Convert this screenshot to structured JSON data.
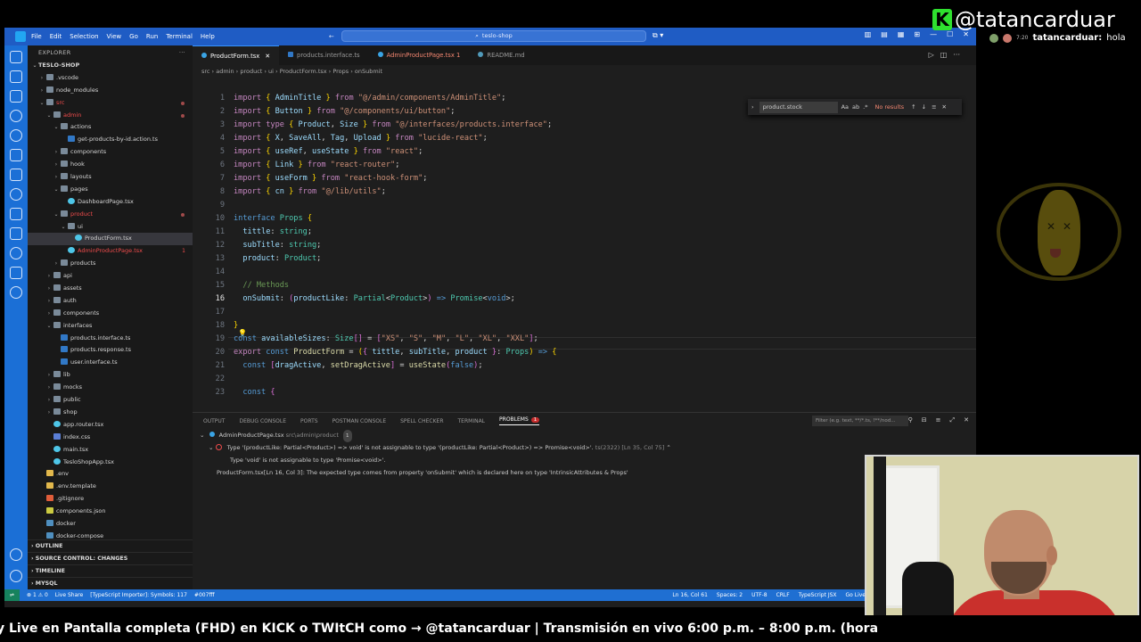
{
  "window": {
    "menu": [
      "File",
      "Edit",
      "Selection",
      "View",
      "Go",
      "Run",
      "Terminal",
      "Help"
    ],
    "search": "teslo-shop"
  },
  "explorer": {
    "title": "EXPLORER",
    "project": "TESLO-SHOP",
    "rows": [
      {
        "label": ".vscode",
        "depth": 1,
        "type": "folder",
        "open": false
      },
      {
        "label": "node_modules",
        "depth": 1,
        "type": "folder",
        "open": false
      },
      {
        "label": "src",
        "depth": 1,
        "type": "folder",
        "open": true,
        "error": true
      },
      {
        "label": "admin",
        "depth": 2,
        "type": "folder",
        "open": true,
        "error": true
      },
      {
        "label": "actions",
        "depth": 3,
        "type": "folder",
        "open": true
      },
      {
        "label": "get-products-by-id.action.ts",
        "depth": 4,
        "type": "ts"
      },
      {
        "label": "components",
        "depth": 3,
        "type": "folder",
        "open": false
      },
      {
        "label": "hook",
        "depth": 3,
        "type": "folder",
        "open": false
      },
      {
        "label": "layouts",
        "depth": 3,
        "type": "folder",
        "open": false
      },
      {
        "label": "pages",
        "depth": 3,
        "type": "folder",
        "open": true
      },
      {
        "label": "DashboardPage.tsx",
        "depth": 4,
        "type": "tsx"
      },
      {
        "label": "product",
        "depth": 3,
        "type": "folder",
        "open": true,
        "error": true
      },
      {
        "label": "ui",
        "depth": 4,
        "type": "folder",
        "open": true
      },
      {
        "label": "ProductForm.tsx",
        "depth": 5,
        "type": "tsx",
        "selected": true
      },
      {
        "label": "AdminProductPage.tsx",
        "depth": 4,
        "type": "tsx",
        "error": true,
        "badge": "1"
      },
      {
        "label": "products",
        "depth": 3,
        "type": "folder",
        "open": false
      },
      {
        "label": "api",
        "depth": 2,
        "type": "folder",
        "open": false
      },
      {
        "label": "assets",
        "depth": 2,
        "type": "folder",
        "open": false
      },
      {
        "label": "auth",
        "depth": 2,
        "type": "folder",
        "open": false
      },
      {
        "label": "components",
        "depth": 2,
        "type": "folder",
        "open": false
      },
      {
        "label": "interfaces",
        "depth": 2,
        "type": "folder",
        "open": true
      },
      {
        "label": "products.interface.ts",
        "depth": 3,
        "type": "ts"
      },
      {
        "label": "products.response.ts",
        "depth": 3,
        "type": "ts"
      },
      {
        "label": "user.interface.ts",
        "depth": 3,
        "type": "ts"
      },
      {
        "label": "lib",
        "depth": 2,
        "type": "folder",
        "open": false
      },
      {
        "label": "mocks",
        "depth": 2,
        "type": "folder",
        "open": false
      },
      {
        "label": "public",
        "depth": 2,
        "type": "folder",
        "open": false
      },
      {
        "label": "shop",
        "depth": 2,
        "type": "folder",
        "open": false
      },
      {
        "label": "app.router.tsx",
        "depth": 2,
        "type": "tsx"
      },
      {
        "label": "index.css",
        "depth": 2,
        "type": "css"
      },
      {
        "label": "main.tsx",
        "depth": 2,
        "type": "tsx"
      },
      {
        "label": "TesloShopApp.tsx",
        "depth": 2,
        "type": "tsx"
      },
      {
        "label": ".env",
        "depth": 1,
        "type": "env"
      },
      {
        "label": ".env.template",
        "depth": 1,
        "type": "env"
      },
      {
        "label": ".gitignore",
        "depth": 1,
        "type": "git"
      },
      {
        "label": "components.json",
        "depth": 1,
        "type": "json"
      },
      {
        "label": "docker",
        "depth": 1,
        "type": "folder-plain"
      },
      {
        "label": "docker-compose",
        "depth": 1,
        "type": "folder-plain"
      }
    ],
    "sections": [
      "OUTLINE",
      "SOURCE CONTROL: CHANGES",
      "TIMELINE",
      "MYSQL"
    ]
  },
  "tabs": [
    {
      "label": "ProductForm.tsx",
      "active": true
    },
    {
      "label": "products.interface.ts",
      "active": false
    },
    {
      "label": "AdminProductPage.tsx 1",
      "active": false,
      "error": true
    },
    {
      "label": "README.md",
      "active": false
    }
  ],
  "breadcrumb": "src › admin › product › ui › ProductForm.tsx › Props › onSubmit",
  "find": {
    "query": "product.stock",
    "result": "No results"
  },
  "code": {
    "current_line": 16,
    "line_numbers": [
      "1",
      "2",
      "3",
      "4",
      "5",
      "6",
      "7",
      "8",
      "9",
      "10",
      "11",
      "12",
      "13",
      "14",
      "15",
      "16",
      "17",
      "18",
      "19",
      "20",
      "21",
      "22",
      "23"
    ]
  },
  "panel": {
    "tabs": [
      "OUTPUT",
      "DEBUG CONSOLE",
      "PORTS",
      "POSTMAN CONSOLE",
      "SPELL CHECKER",
      "TERMINAL",
      "PROBLEMS"
    ],
    "problems_count": "1",
    "filter_placeholder": "Filter (e.g. text, **/*.ts, !**/nod...",
    "file": "AdminProductPage.tsx",
    "file_path": "src\\admin\\product",
    "file_count": "1",
    "error_main": "Type '(productLike: Partial<Product>) => void' is not assignable to type '(productLike: Partial<Product>) => Promise<void>'.",
    "error_code": "ts(2322) [Ln 35, Col 75]",
    "error_sub": "Type 'void' is not assignable to type 'Promise<void>'.",
    "related": "ProductForm.tsx[Ln 16, Col 3]: The expected type comes from property 'onSubmit' which is declared here on type 'IntrinsicAttributes & Props'"
  },
  "statusbar": {
    "errors": "⊗ 1 ⚠ 0",
    "live_share": "Live Share",
    "importer": "[TypeScript Importer]: Symbols: 117",
    "color": "#007fff",
    "position": "Ln 16, Col 61",
    "spaces": "Spaces: 2",
    "encoding": "UTF-8",
    "eol": "CRLF",
    "language": "TypeScript JSX",
    "golive": "Go Live"
  },
  "overlay": {
    "brand": "@tatancarduar",
    "chat_time": "7:20",
    "chat_user": "tatancarduar:",
    "chat_msg": "hola",
    "ticker": "y Live en Pantalla completa (FHD)  en KICK  o TWItCH como → @tatancarduar      |      Transmisión en vivo  6:00 p.m. – 8:00 p.m. (hora"
  }
}
